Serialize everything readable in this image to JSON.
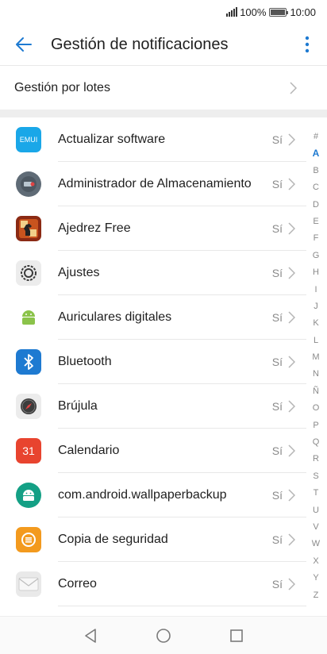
{
  "status_bar": {
    "battery": "100%",
    "time": "10:00",
    "icons": [
      "signal-icon",
      "battery-icon"
    ]
  },
  "header": {
    "title": "Gestión de notificaciones",
    "back_icon": "arrow-left-icon",
    "menu_icon": "more-vertical-icon",
    "accent_color": "#1e7ad1"
  },
  "batch": {
    "label": "Gestión por lotes"
  },
  "apps": [
    {
      "name": "Actualizar software",
      "state": "Sí",
      "icon": "emui-icon",
      "icon_text": "EMUI",
      "color": "#1aa7e8"
    },
    {
      "name": "Administrador de Almacenamiento",
      "state": "Sí",
      "icon": "storage-manager-icon",
      "color": "#5f6b76"
    },
    {
      "name": "Ajedrez Free",
      "state": "Sí",
      "icon": "chess-icon",
      "color": "#8b2a14"
    },
    {
      "name": "Ajustes",
      "state": "Sí",
      "icon": "settings-gear-icon",
      "color": "#ececec"
    },
    {
      "name": "Auriculares digitales",
      "state": "Sí",
      "icon": "android-icon",
      "color": "#ffffff"
    },
    {
      "name": "Bluetooth",
      "state": "Sí",
      "icon": "bluetooth-icon",
      "color": "#1e7ad1"
    },
    {
      "name": "Brújula",
      "state": "Sí",
      "icon": "compass-icon",
      "color": "#ececec"
    },
    {
      "name": "Calendario",
      "state": "Sí",
      "icon": "calendar-icon",
      "icon_text": "31",
      "color": "#e8442f"
    },
    {
      "name": "com.android.wallpaperbackup",
      "state": "Sí",
      "icon": "android-icon",
      "color": "#14a085"
    },
    {
      "name": "Copia de seguridad",
      "state": "Sí",
      "icon": "backup-icon",
      "color": "#f39a1e"
    },
    {
      "name": "Correo",
      "state": "Sí",
      "icon": "mail-icon",
      "color": "#e9e9e9"
    }
  ],
  "alpha_index": [
    "#",
    "A",
    "B",
    "C",
    "D",
    "E",
    "F",
    "G",
    "H",
    "I",
    "J",
    "K",
    "L",
    "M",
    "N",
    "Ñ",
    "O",
    "P",
    "Q",
    "R",
    "S",
    "T",
    "U",
    "V",
    "W",
    "X",
    "Y",
    "Z"
  ],
  "alpha_active": "A",
  "nav_bar": {
    "back_icon": "nav-back-icon",
    "home_icon": "nav-home-icon",
    "recents_icon": "nav-recents-icon"
  }
}
